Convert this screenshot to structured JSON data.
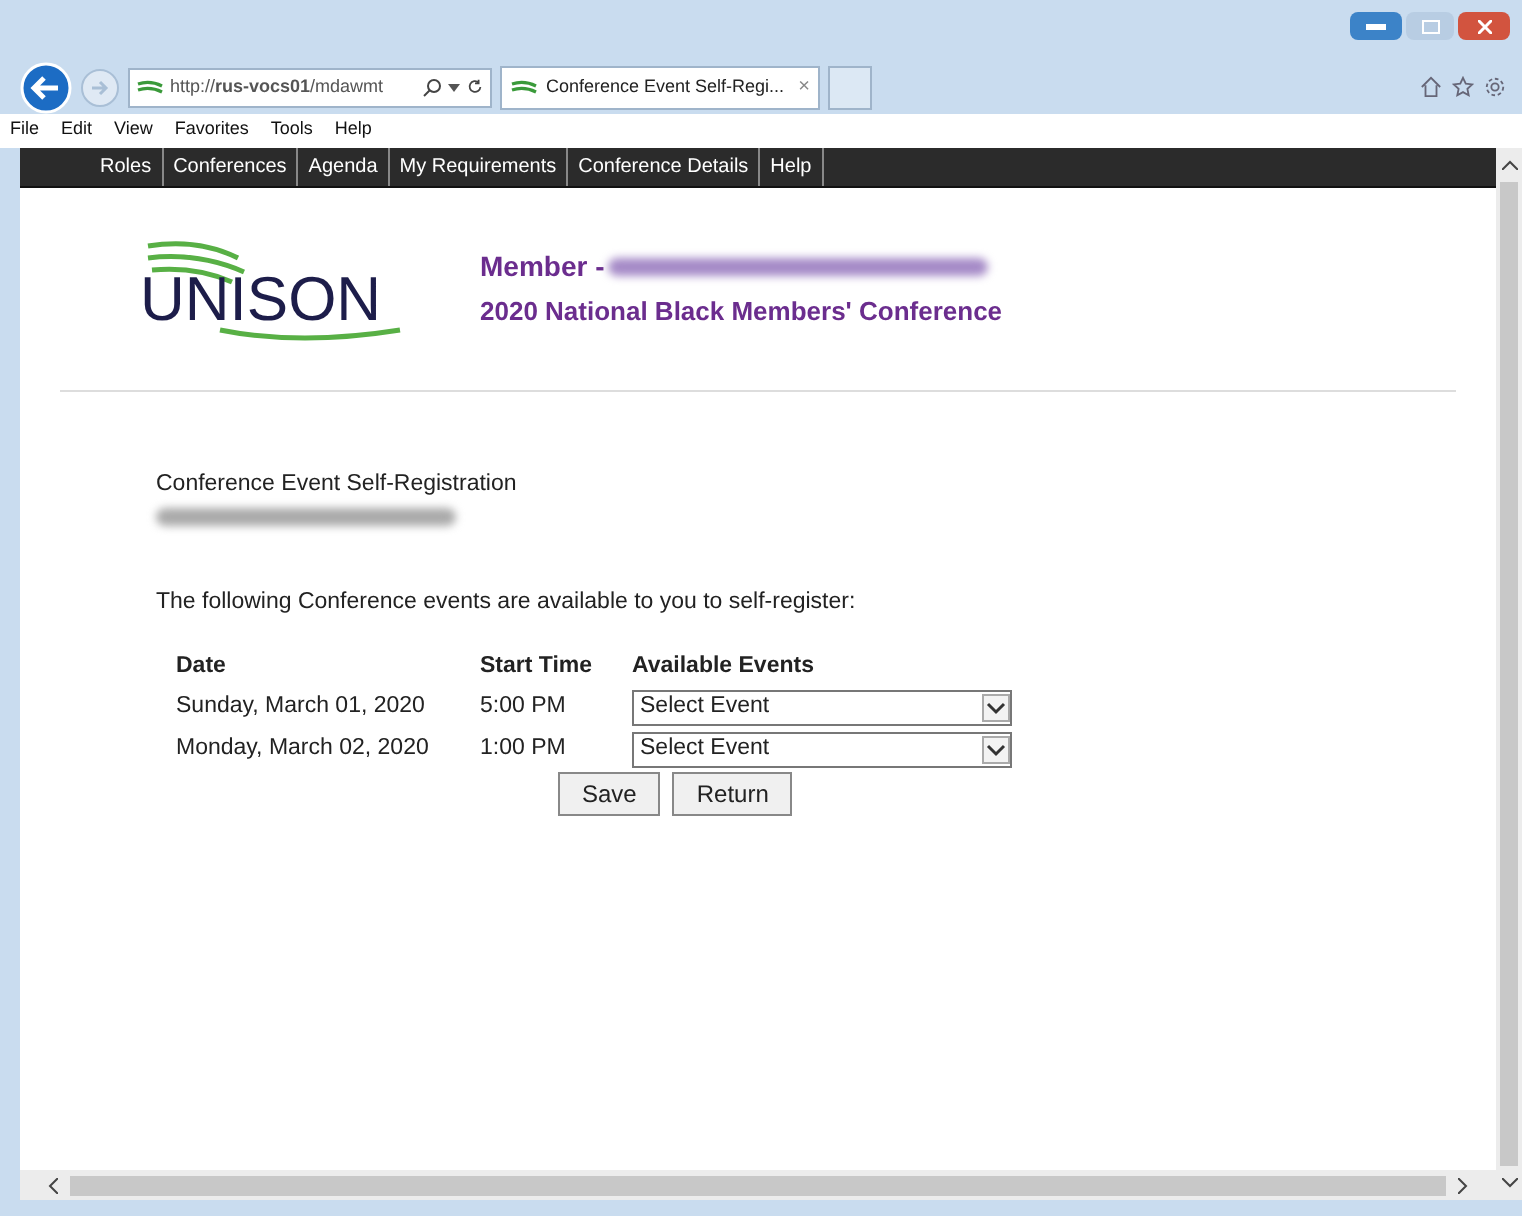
{
  "browser": {
    "address": "http://**rus-vocs01**/mdawmt",
    "tab_title": "Conference Event Self-Regi...",
    "tab_close": "×",
    "menu": [
      "File",
      "Edit",
      "View",
      "Favorites",
      "Tools",
      "Help"
    ]
  },
  "nav": [
    {
      "label": "Roles"
    },
    {
      "label": "Conferences"
    },
    {
      "label": "Agenda"
    },
    {
      "label": "My Requirements"
    },
    {
      "label": "Conference Details"
    },
    {
      "label": "Help"
    }
  ],
  "header": {
    "logo": "UNISON",
    "member_label": "Member -",
    "conference": "2020 National Black Members' Conference"
  },
  "page": {
    "title": "Conference Event Self-Registration",
    "intro": "The following Conference events are available to you to self-register:"
  },
  "table": {
    "columns": [
      "Date",
      "Start Time",
      "Available Events"
    ],
    "rows": [
      {
        "date": "Sunday, March 01, 2020",
        "start_time": "5:00 PM",
        "event": "Select Event"
      },
      {
        "date": "Monday, March 02, 2020",
        "start_time": "1:00 PM",
        "event": "Select Event"
      }
    ]
  },
  "buttons": [
    "Save",
    "Return"
  ]
}
